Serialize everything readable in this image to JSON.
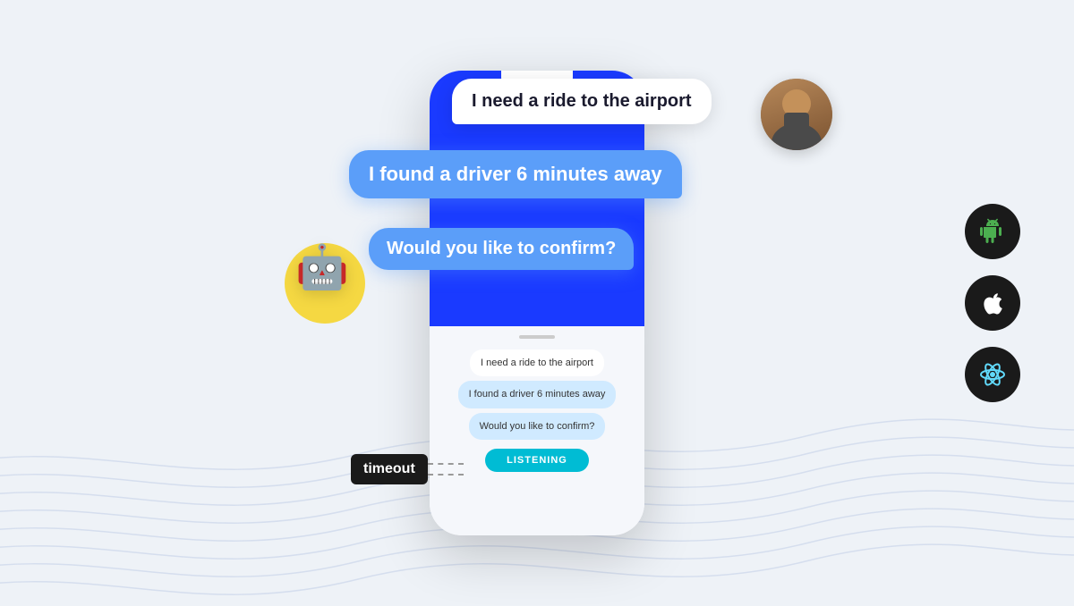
{
  "background": {
    "color": "#eef2f7"
  },
  "chat": {
    "user_message_1": "I need a ride to the airport",
    "bot_message_1": "I found a driver 6 minutes away",
    "bot_message_2": "Would you like to confirm?",
    "phone_messages": [
      {
        "text": "I need a ride to the airport",
        "type": "user"
      },
      {
        "text": "I found a driver 6 minutes away",
        "type": "bot"
      },
      {
        "text": "Would you like to confirm?",
        "type": "bot"
      }
    ],
    "listen_button": "LISTENING"
  },
  "timeout_badge": "timeout",
  "platforms": [
    {
      "name": "Android",
      "icon": "🤖",
      "color": "#4CAF50"
    },
    {
      "name": "Apple",
      "icon": "🍎",
      "color": "#ffffff"
    },
    {
      "name": "React Native",
      "icon": "⚛",
      "color": "#61dafb"
    }
  ]
}
